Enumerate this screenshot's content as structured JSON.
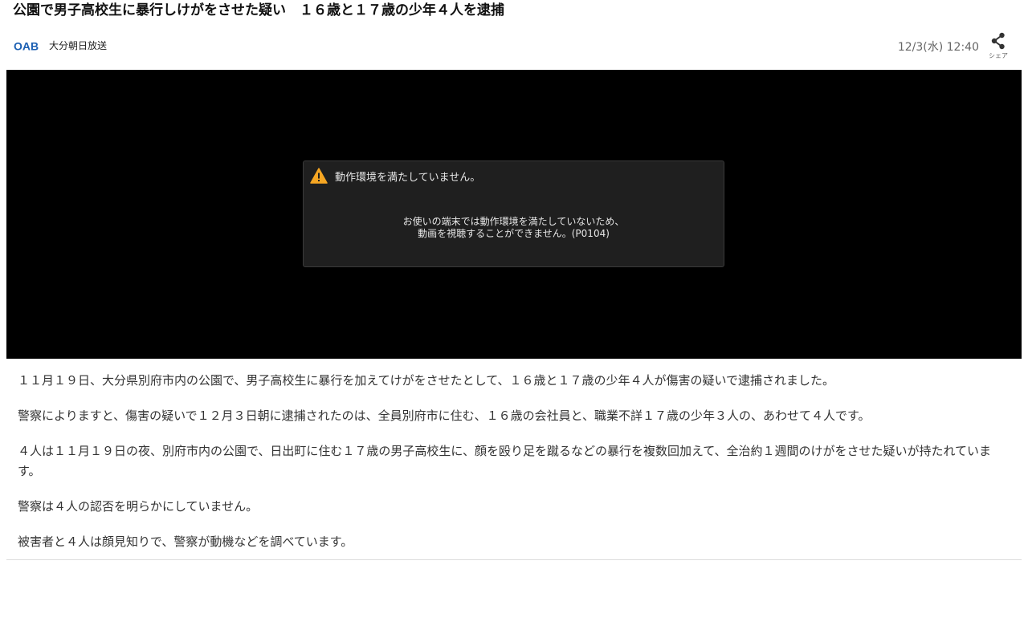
{
  "article": {
    "title": "公園で男子高校生に暴行しけがをさせた疑い　１６歳と１７歳の少年４人を逮捕",
    "source": {
      "logo_text": "OAB",
      "name": "大分朝日放送",
      "logo_color": "#1b5fb2"
    },
    "datetime": "12/3(水) 12:40",
    "share_label": "シェア",
    "paragraphs": [
      "１１月１９日、大分県別府市内の公園で、男子高校生に暴行を加えてけがをさせたとして、１６歳と１７歳の少年４人が傷害の疑いで逮捕されました。",
      "警察によりますと、傷害の疑いで１２月３日朝に逮捕されたのは、全員別府市に住む、１６歳の会社員と、職業不詳１７歳の少年３人の、あわせて４人です。",
      "４人は１１月１９日の夜、別府市内の公園で、日出町に住む１７歳の男子高校生に、顔を殴り足を蹴るなどの暴行を複数回加えて、全治約１週間のけがをさせた疑いが持たれています。",
      "警察は４人の認否を明らかにしていません。",
      "被害者と４人は顔見知りで、警察が動機などを調べています。"
    ]
  },
  "video_player": {
    "error": {
      "icon": "warning-icon",
      "icon_color": "#f5a623",
      "title": "動作環境を満たしていません。",
      "message_line1": "お使いの端末では動作環境を満たしていないため、",
      "message_line2": "動画を視聴することができません。(P0104)"
    }
  }
}
